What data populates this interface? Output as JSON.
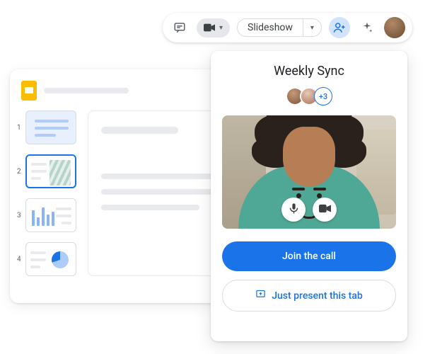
{
  "toolbar": {
    "slideshow_label": "Slideshow"
  },
  "editor": {
    "thumbs": [
      {
        "num": "1"
      },
      {
        "num": "2"
      },
      {
        "num": "3"
      },
      {
        "num": "4"
      }
    ]
  },
  "meet": {
    "title": "Weekly Sync",
    "extra_attendees": "+3",
    "join_label": "Join the call",
    "present_label": "Just present this tab"
  },
  "colors": {
    "primary": "#1a73e8",
    "primary_light": "#d2e3fc"
  }
}
